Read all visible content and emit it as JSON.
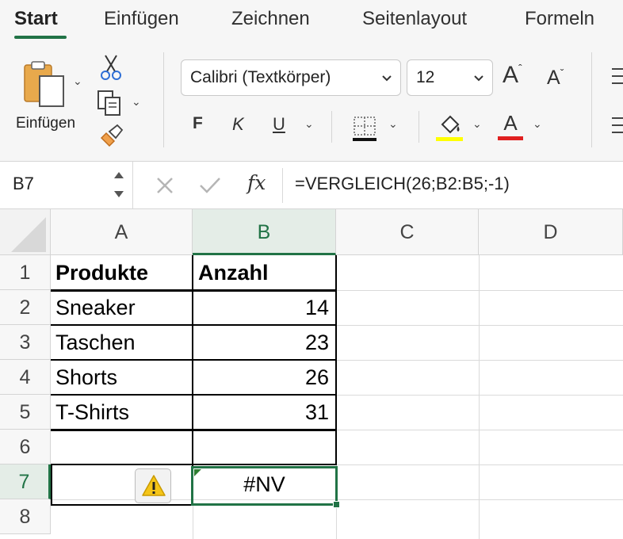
{
  "ribbon": {
    "tabs": [
      {
        "label": "Start",
        "active": true
      },
      {
        "label": "Einfügen",
        "active": false
      },
      {
        "label": "Zeichnen",
        "active": false
      },
      {
        "label": "Seitenlayout",
        "active": false
      },
      {
        "label": "Formeln",
        "active": false
      }
    ],
    "paste_label": "Einfügen",
    "font_name": "Calibri (Textkörper)",
    "font_size": "12",
    "bold_label": "F",
    "italic_label": "K",
    "underline_label": "U",
    "grow_font_label": "A",
    "shrink_font_label": "A",
    "font_color_label": "A",
    "fill_color": "#ffff00",
    "font_color": "#e02020",
    "accent_color": "#217346"
  },
  "formula_bar": {
    "name_box": "B7",
    "fx_label": "fx",
    "formula": "=VERGLEICH(26;B2:B5;-1)"
  },
  "grid": {
    "columns": [
      "A",
      "B",
      "C",
      "D"
    ],
    "rows": [
      "1",
      "2",
      "3",
      "4",
      "5",
      "6",
      "7",
      "8"
    ],
    "selected_cell": "B7",
    "cells": {
      "A1": "Produkte",
      "B1": "Anzahl",
      "A2": "Sneaker",
      "B2": "14",
      "A3": "Taschen",
      "B3": "23",
      "A4": "Shorts",
      "B4": "26",
      "A5": "T-Shirts",
      "B5": "31",
      "B7": "#NV"
    }
  }
}
